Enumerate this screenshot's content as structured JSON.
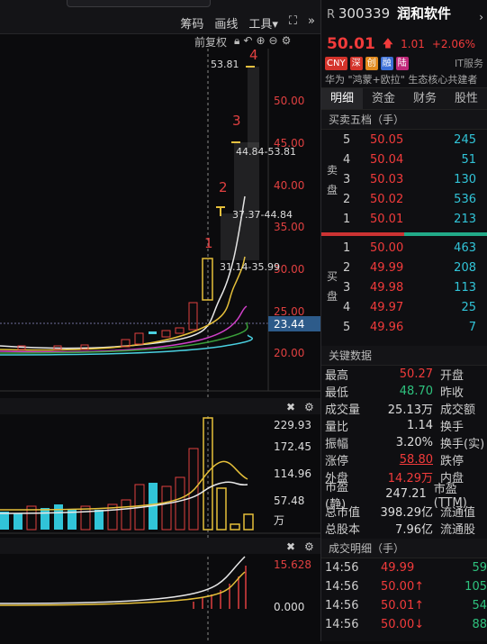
{
  "toolbar": {
    "items": [
      "筹码",
      "画线",
      "工具▾"
    ],
    "fuquan": "前复权"
  },
  "chart_data": [
    {
      "type": "candlestick",
      "y_ticks": [
        "50.00",
        "45.00",
        "40.00",
        "35.00",
        "30.00",
        "25.00",
        "20.00"
      ],
      "current_price_label": "23.44",
      "annotations": [
        {
          "text": "53.81",
          "kind": "high"
        },
        {
          "text": "44.84-53.81",
          "kind": "range"
        },
        {
          "text": "37.37-44.84",
          "kind": "range"
        },
        {
          "text": "31.14-35.99",
          "kind": "range"
        }
      ],
      "board_counts": [
        "1",
        "2",
        "3",
        "4"
      ]
    },
    {
      "type": "bar",
      "title": "volume",
      "y_ticks": [
        "229.93",
        "172.45",
        "114.96",
        "57.48",
        "万"
      ]
    },
    {
      "type": "line",
      "title": "indicator",
      "y_ticks": [
        "15.628",
        "0.000"
      ]
    }
  ],
  "stock": {
    "prefix": "R",
    "code": "300339",
    "name": "润和软件",
    "price": "50.01",
    "change": "1.01",
    "change_pct": "+2.06%",
    "tags": [
      {
        "label": "CNY",
        "color": "#d4332b"
      },
      {
        "label": "深",
        "color": "#d4332b"
      },
      {
        "label": "创",
        "color": "#e28a1e"
      },
      {
        "label": "融",
        "color": "#3b6fd6"
      },
      {
        "label": "陆",
        "color": "#c0287a"
      }
    ],
    "tag_extra": "IT服务",
    "concept": "华为 \"鸿蒙+欧拉\" 生态核心共建者"
  },
  "tabs": [
    "明细",
    "资金",
    "财务",
    "股性"
  ],
  "orderbook": {
    "title": "买卖五档（手）",
    "sell_label": [
      "卖",
      "盘"
    ],
    "buy_label": [
      "买",
      "盘"
    ],
    "sells": [
      {
        "n": "5",
        "price": "50.05",
        "vol": "245"
      },
      {
        "n": "4",
        "price": "50.04",
        "vol": "51"
      },
      {
        "n": "3",
        "price": "50.03",
        "vol": "130"
      },
      {
        "n": "2",
        "price": "50.02",
        "vol": "536"
      },
      {
        "n": "1",
        "price": "50.01",
        "vol": "213"
      }
    ],
    "buys": [
      {
        "n": "1",
        "price": "50.00",
        "vol": "463"
      },
      {
        "n": "2",
        "price": "49.99",
        "vol": "208"
      },
      {
        "n": "3",
        "price": "49.98",
        "vol": "113"
      },
      {
        "n": "4",
        "price": "49.97",
        "vol": "25"
      },
      {
        "n": "5",
        "price": "49.96",
        "vol": "7"
      }
    ]
  },
  "key_data": {
    "title": "关键数据",
    "rows": [
      {
        "label": "最高",
        "value": "50.27",
        "color": "red",
        "label2": "开盘"
      },
      {
        "label": "最低",
        "value": "48.70",
        "color": "green",
        "label2": "昨收"
      },
      {
        "label": "成交量",
        "value": "25.13万",
        "color": "white",
        "label2": "成交额"
      },
      {
        "label": "量比",
        "value": "1.14",
        "color": "white",
        "label2": "换手"
      },
      {
        "label": "振幅",
        "value": "3.20%",
        "color": "white",
        "label2": "换手(实)"
      },
      {
        "label": "涨停",
        "value": "58.80",
        "color": "red",
        "label2": "跌停"
      },
      {
        "label": "外盘",
        "value": "14.29万",
        "color": "red",
        "label2": "内盘"
      },
      {
        "label": "市盈(静)",
        "value": "247.21",
        "color": "white",
        "label2": "市盈(TTM)"
      },
      {
        "label": "总市值",
        "value": "398.29亿",
        "color": "white",
        "label2": "流通值"
      },
      {
        "label": "总股本",
        "value": "7.96亿",
        "color": "white",
        "label2": "流通股"
      }
    ]
  },
  "trades": {
    "title": "成交明细（手）",
    "rows": [
      {
        "time": "14:56",
        "price": "49.99",
        "vol": "59",
        "arrow": ""
      },
      {
        "time": "14:56",
        "price": "50.00↑",
        "vol": "105",
        "arrow": ""
      },
      {
        "time": "14:56",
        "price": "50.01↑",
        "vol": "54",
        "arrow": ""
      },
      {
        "time": "14:56",
        "price": "50.00↓",
        "vol": "88",
        "arrow": ""
      }
    ]
  }
}
